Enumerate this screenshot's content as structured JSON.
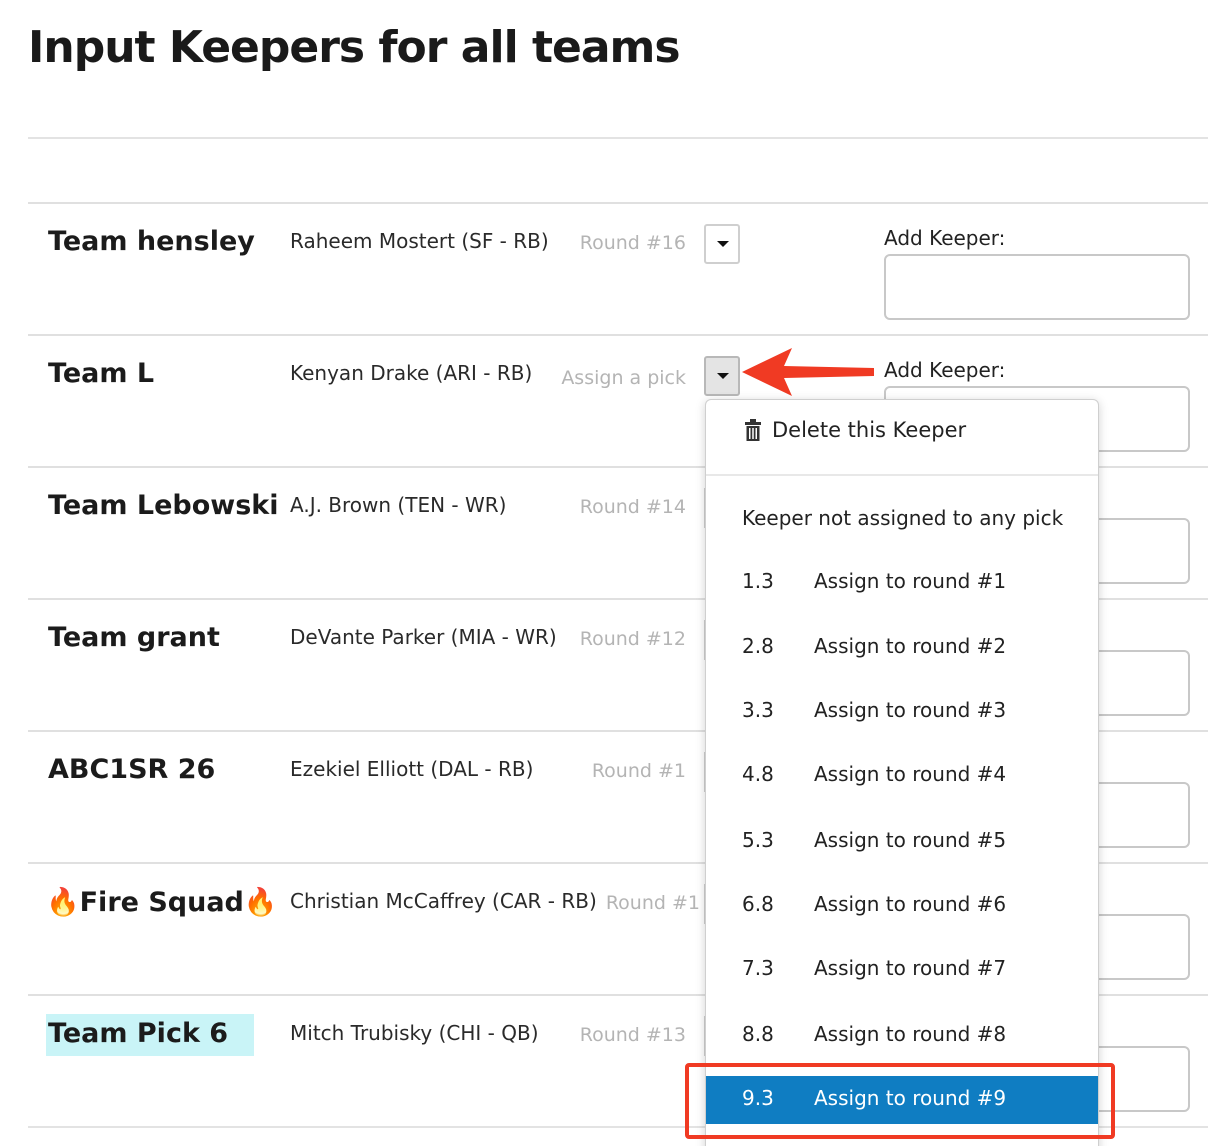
{
  "page": {
    "title": "Input Keepers for all teams"
  },
  "teams": [
    {
      "name": "Team hensley",
      "player": "Raheem Mostert (SF - RB)",
      "round": "Round #16",
      "add_label": "Add Keeper:"
    },
    {
      "name": "Team L",
      "player": "Kenyan Drake (ARI - RB)",
      "round": "Assign a pick",
      "add_label": "Add Keeper:"
    },
    {
      "name": "Team Lebowski",
      "player": "A.J. Brown (TEN - WR)",
      "round": "Round #14"
    },
    {
      "name": "Team grant",
      "player": "DeVante Parker (MIA - WR)",
      "round": "Round #12"
    },
    {
      "name": "ABC1SR 26",
      "player": "Ezekiel Elliott (DAL - RB)",
      "round": "Round #1"
    },
    {
      "name": "🔥Fire Squad🔥",
      "player": "Christian McCaffrey (CAR - RB)",
      "round": "Round #1"
    },
    {
      "name": "Team Pick 6",
      "player": "Mitch Trubisky (CHI - QB)",
      "round": "Round #13"
    }
  ],
  "menu": {
    "delete_label": "Delete this Keeper",
    "unassigned_label": "Keeper not assigned to any pick",
    "items": [
      {
        "pick": "1.3",
        "label": "Assign to round #1"
      },
      {
        "pick": "2.8",
        "label": "Assign to round #2"
      },
      {
        "pick": "3.3",
        "label": "Assign to round #3"
      },
      {
        "pick": "4.8",
        "label": "Assign to round #4"
      },
      {
        "pick": "5.3",
        "label": "Assign to round #5"
      },
      {
        "pick": "6.8",
        "label": "Assign to round #6"
      },
      {
        "pick": "7.3",
        "label": "Assign to round #7"
      },
      {
        "pick": "8.8",
        "label": "Assign to round #8"
      },
      {
        "pick": "9.3",
        "label": "Assign to round #9"
      }
    ],
    "selected_index": 8,
    "selected_color": "#0f7dc2"
  },
  "annotations": {
    "arrow_color": "#f03a23",
    "highlight_box_color": "#f03a23",
    "team_highlight_color": "#c9f4f7"
  }
}
